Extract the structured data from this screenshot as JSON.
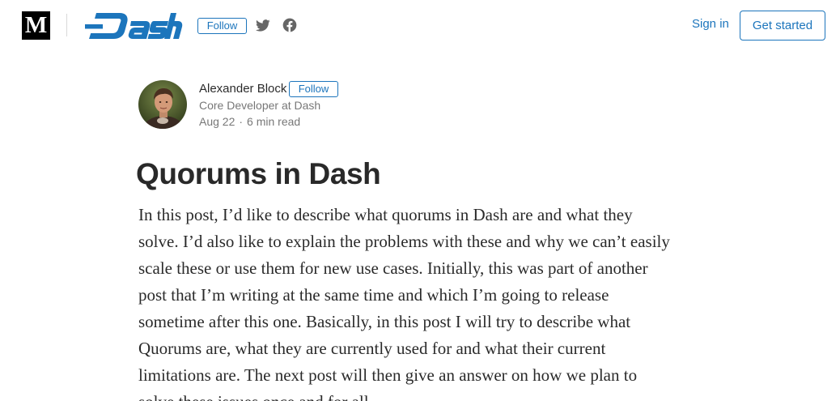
{
  "header": {
    "site_logo_letter": "M",
    "publication_name": "Dash",
    "follow_label": "Follow",
    "sign_in_label": "Sign in",
    "get_started_label": "Get started",
    "brand_color": "#1c75bc",
    "icons": [
      "medium-logo",
      "twitter-icon",
      "facebook-icon"
    ]
  },
  "author": {
    "name": "Alexander Block",
    "follow_label": "Follow",
    "bio": "Core Developer at Dash",
    "date": "Aug 22",
    "separator": "·",
    "read_time": "6 min read"
  },
  "article": {
    "title": "Quorums in Dash",
    "body_lines": [
      "In this post, I’d like to describe what quorums in Dash are and what they",
      "solve. I’d also like to explain the problems with these and why we can’t easily",
      "scale these or use them for new use cases. Initially, this was part of another",
      "post that I’m writing at the same time and which I’m going to release",
      "sometime after this one. Basically, in this post I will try to describe what",
      "Quorums are, what they are currently used for and what their current",
      "limitations are. The next post will then give an answer on how we plan to",
      "solve these issues once and for all."
    ]
  }
}
